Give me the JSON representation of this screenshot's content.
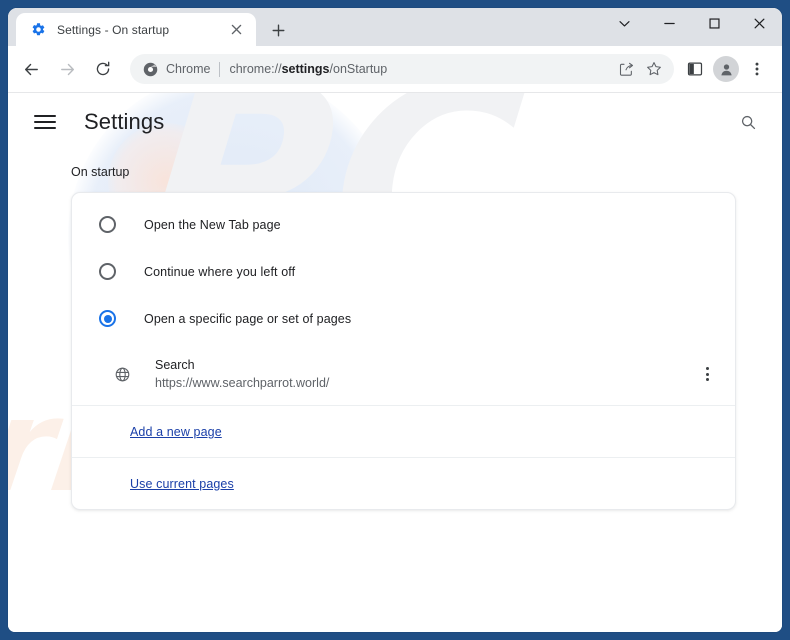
{
  "browser": {
    "tab": {
      "title": "Settings - On startup",
      "favicon_icon": "gear-icon",
      "close_icon": "close-icon"
    },
    "new_tab_icon": "plus-icon",
    "caption": {
      "tab_search_icon": "chevron-down-icon",
      "minimize_icon": "minimize-icon",
      "maximize_icon": "maximize-icon",
      "close_icon": "close-icon"
    },
    "toolbar": {
      "back_icon": "back-arrow-icon",
      "forward_icon": "forward-arrow-icon",
      "reload_icon": "reload-icon",
      "chrome_identity_icon": "chrome-logo-icon",
      "chrome_identity_label": "Chrome",
      "url_prefix": "chrome://",
      "url_bold": "settings",
      "url_suffix": "/onStartup",
      "share_icon": "share-icon",
      "bookmark_icon": "star-icon",
      "side_panel_icon": "side-panel-icon",
      "profile_icon": "profile-avatar-icon",
      "menu_icon": "three-dot-menu-icon"
    }
  },
  "settings": {
    "menu_icon": "hamburger-menu-icon",
    "title": "Settings",
    "search_icon": "search-icon",
    "section_label": "On startup",
    "options": [
      {
        "label": "Open the New Tab page",
        "selected": false
      },
      {
        "label": "Continue where you left off",
        "selected": false
      },
      {
        "label": "Open a specific page or set of pages",
        "selected": true
      }
    ],
    "startup_page": {
      "favicon_icon": "globe-icon",
      "name": "Search",
      "url": "https://www.searchparrot.world/",
      "menu_icon": "three-dot-menu-icon"
    },
    "links": [
      {
        "label": "Add a new page"
      },
      {
        "label": "Use current pages"
      }
    ]
  },
  "watermark": {
    "primary_text": "PC",
    "secondary_text": "risk.com",
    "primary_color": "#f1f2f4",
    "secondary_color": "#fcf0e8"
  },
  "colors": {
    "window_frame": "#1f4e84",
    "tab_strip": "#dee1e6",
    "accent": "#1a73e8",
    "link": "#1a3fa8",
    "text_primary": "#202124",
    "text_secondary": "#5f6368"
  }
}
